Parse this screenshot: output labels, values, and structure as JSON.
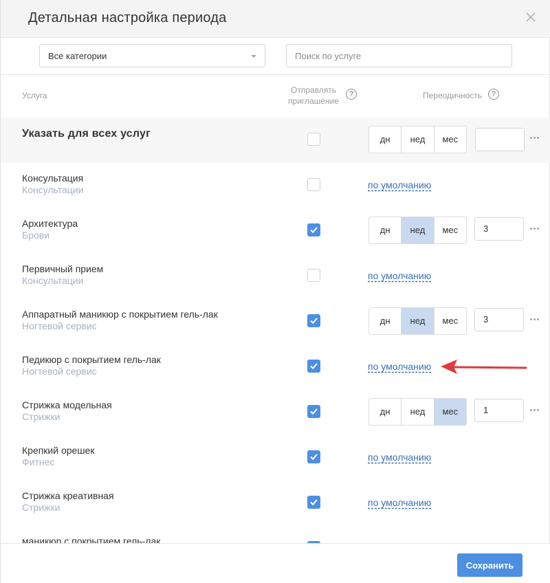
{
  "dialog": {
    "title": "Детальная настройка периода"
  },
  "filters": {
    "category_select_value": "Все категории",
    "search_placeholder": "Поиск по услуге"
  },
  "columns": {
    "service": "Услуга",
    "invite": "Отправлять приглашение",
    "periodicity": "Переодичность",
    "help_glyph": "?"
  },
  "all_services": {
    "label": "Указать для всех услуг",
    "send_invite": false,
    "options": [
      "дн",
      "нед",
      "мес"
    ],
    "value": ""
  },
  "services": [
    {
      "name": "Консультация",
      "category": "Консультации",
      "send_invite": false,
      "mode": "default",
      "default_label": "по умолчанию"
    },
    {
      "name": "Архитектура",
      "category": "Брови",
      "send_invite": true,
      "mode": "custom",
      "options": [
        "дн",
        "нед",
        "мес"
      ],
      "active_option": "нед",
      "value": "3"
    },
    {
      "name": "Первичный прием",
      "category": "Консультации",
      "send_invite": false,
      "mode": "default",
      "default_label": "по умолчанию"
    },
    {
      "name": "Аппаратный маникюр с покрытием гель-лак",
      "category": "Ногтевой сервис",
      "send_invite": true,
      "mode": "custom",
      "options": [
        "дн",
        "нед",
        "мес"
      ],
      "active_option": "нед",
      "value": "3"
    },
    {
      "name": "Педикюр с покрытием гель-лак",
      "category": "Ногтевой сервис",
      "send_invite": true,
      "mode": "default",
      "default_label": "по умолчанию"
    },
    {
      "name": "Стрижка модельная",
      "category": "Стрижки",
      "send_invite": true,
      "mode": "custom",
      "options": [
        "дн",
        "нед",
        "мес"
      ],
      "active_option": "мес",
      "value": "1"
    },
    {
      "name": "Крепкий орешек",
      "category": "Фитнес",
      "send_invite": true,
      "mode": "default",
      "default_label": "по умолчанию"
    },
    {
      "name": "Стрижка креативная",
      "category": "Стрижки",
      "send_invite": true,
      "mode": "default",
      "default_label": "по умолчанию"
    },
    {
      "name": "маникюр с покрытием гель-лак",
      "category": "",
      "send_invite": true,
      "mode": "hidden"
    }
  ],
  "footer": {
    "save_label": "Сохранить"
  },
  "colors": {
    "accent": "#4d8fe0",
    "active_segment": "#c9d9ef",
    "link": "#3b6fb6",
    "category_text": "#a7b2c3",
    "annotation_arrow": "#e03a3a"
  }
}
